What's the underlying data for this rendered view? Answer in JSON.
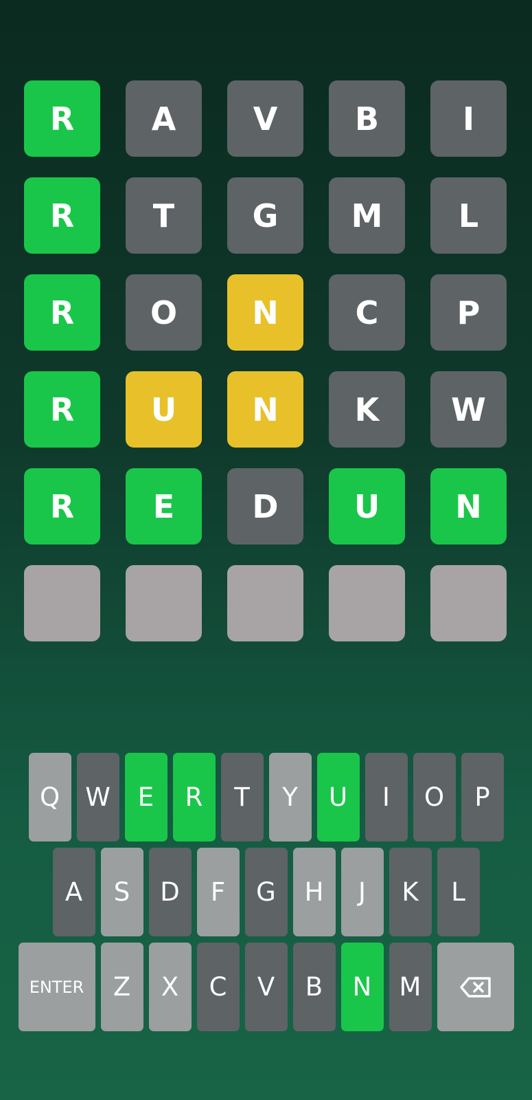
{
  "board": {
    "rows": [
      {
        "letters": [
          "R",
          "A",
          "V",
          "B",
          "I"
        ],
        "states": [
          "green",
          "gray",
          "gray",
          "gray",
          "gray"
        ]
      },
      {
        "letters": [
          "R",
          "T",
          "G",
          "M",
          "L"
        ],
        "states": [
          "green",
          "gray",
          "gray",
          "gray",
          "gray"
        ]
      },
      {
        "letters": [
          "R",
          "O",
          "N",
          "C",
          "P"
        ],
        "states": [
          "green",
          "gray",
          "yellow",
          "gray",
          "gray"
        ]
      },
      {
        "letters": [
          "R",
          "U",
          "N",
          "K",
          "W"
        ],
        "states": [
          "green",
          "yellow",
          "yellow",
          "gray",
          "gray"
        ]
      },
      {
        "letters": [
          "R",
          "E",
          "D",
          "U",
          "N"
        ],
        "states": [
          "green",
          "green",
          "gray",
          "green",
          "green"
        ]
      },
      {
        "letters": [
          "",
          "",
          "",
          "",
          ""
        ],
        "states": [
          "empty",
          "empty",
          "empty",
          "empty",
          "empty"
        ]
      }
    ]
  },
  "keyboard": {
    "row1": [
      {
        "label": "Q",
        "state": "light"
      },
      {
        "label": "W",
        "state": "gray"
      },
      {
        "label": "E",
        "state": "green"
      },
      {
        "label": "R",
        "state": "green"
      },
      {
        "label": "T",
        "state": "gray"
      },
      {
        "label": "Y",
        "state": "light"
      },
      {
        "label": "U",
        "state": "green"
      },
      {
        "label": "I",
        "state": "gray"
      },
      {
        "label": "O",
        "state": "gray"
      },
      {
        "label": "P",
        "state": "gray"
      }
    ],
    "row2": [
      {
        "label": "A",
        "state": "gray"
      },
      {
        "label": "S",
        "state": "light"
      },
      {
        "label": "D",
        "state": "gray"
      },
      {
        "label": "F",
        "state": "light"
      },
      {
        "label": "G",
        "state": "gray"
      },
      {
        "label": "H",
        "state": "light"
      },
      {
        "label": "J",
        "state": "light"
      },
      {
        "label": "K",
        "state": "gray"
      },
      {
        "label": "L",
        "state": "gray"
      }
    ],
    "row3": [
      {
        "label": "ENTER",
        "state": "light"
      },
      {
        "label": "Z",
        "state": "light"
      },
      {
        "label": "X",
        "state": "light"
      },
      {
        "label": "C",
        "state": "gray"
      },
      {
        "label": "V",
        "state": "gray"
      },
      {
        "label": "B",
        "state": "gray"
      },
      {
        "label": "N",
        "state": "green"
      },
      {
        "label": "M",
        "state": "gray"
      },
      {
        "label": "backspace-icon",
        "state": "light"
      }
    ]
  },
  "colors": {
    "green": "#1ac64a",
    "yellow": "#e8c12a",
    "gray": "#5e6366",
    "light": "#9b9fa0",
    "empty": "#a8a4a5"
  }
}
